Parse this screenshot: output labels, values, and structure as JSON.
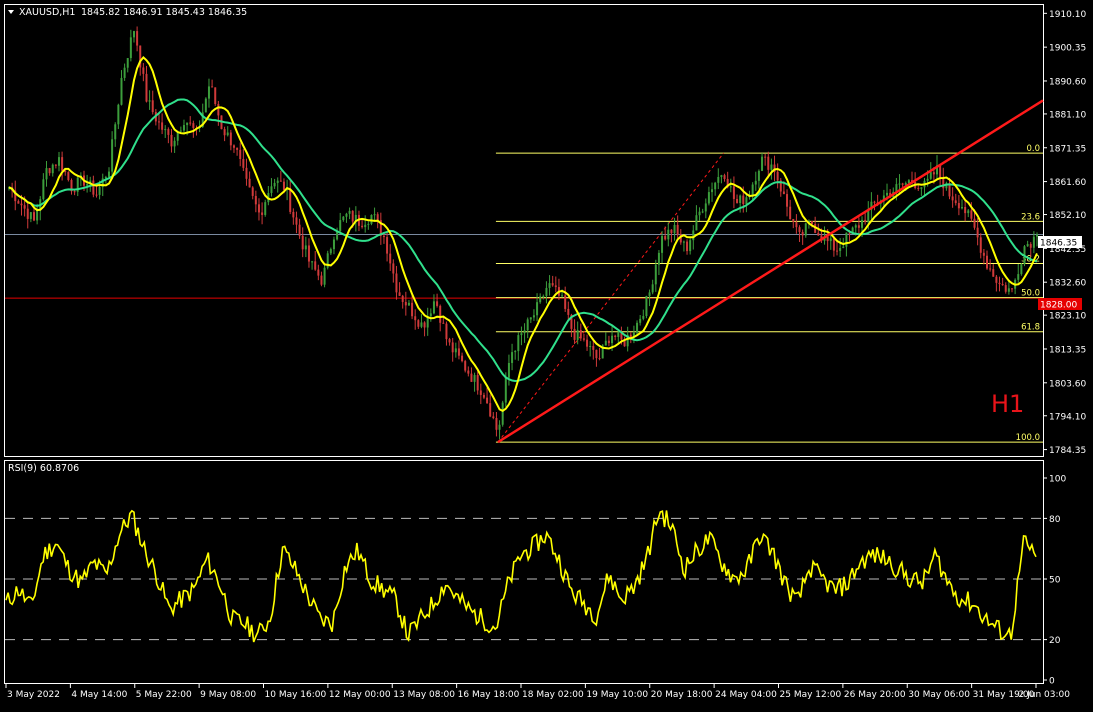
{
  "main": {
    "header": {
      "symbol": "XAUUSD,H1",
      "ohlc": "1845.82 1846.91 1845.43 1846.35"
    },
    "timeframe_label": "H1",
    "current_price_label": "1846.35",
    "level_price_label": "1828.00",
    "fib_labels": [
      "0.0",
      "23.6",
      "38.2",
      "50.0",
      "61.8",
      "100.0"
    ]
  },
  "rsi": {
    "header": "RSI(9) 60.8706"
  },
  "colors": {
    "background": "#000000",
    "axis": "#FFFFFF",
    "bull_candle": "#3C9E3C",
    "bear_candle": "#D03A3A",
    "ma_fast": "#FFFF00",
    "ma_slow": "#30E08C",
    "trendline": "#FF1A1A",
    "fib": "#FFFF66",
    "rsi_line": "#FFFF00",
    "h1_label": "#E8141A",
    "current_price_box": "#FFFFFF",
    "level_box": "#E60000"
  },
  "chart_data": [
    {
      "type": "candlestick",
      "title": "XAUUSD,H1",
      "y_ticks": [
        1910.1,
        1900.35,
        1890.6,
        1881.1,
        1871.35,
        1861.6,
        1852.1,
        1842.35,
        1832.6,
        1823.1,
        1813.35,
        1803.6,
        1794.1,
        1784.35
      ],
      "ylim": [
        1782.5,
        1912.5
      ],
      "x_ticks": [
        "3 May 2022",
        "4 May 14:00",
        "5 May 22:00",
        "9 May 08:00",
        "10 May 16:00",
        "12 May 00:00",
        "13 May 08:00",
        "16 May 18:00",
        "18 May 02:00",
        "19 May 10:00",
        "20 May 18:00",
        "24 May 04:00",
        "25 May 12:00",
        "26 May 20:00",
        "30 May 06:00",
        "31 May 19:00",
        "2 Jun 03:00"
      ],
      "close_path": [
        1860,
        1855,
        1850,
        1865,
        1868,
        1860,
        1862,
        1858,
        1866,
        1892,
        1906,
        1885,
        1878,
        1873,
        1880,
        1875,
        1890,
        1877,
        1872,
        1860,
        1852,
        1862,
        1860,
        1848,
        1838,
        1833,
        1848,
        1852,
        1850,
        1852,
        1845,
        1830,
        1825,
        1820,
        1828,
        1815,
        1810,
        1805,
        1800,
        1789,
        1812,
        1818,
        1824,
        1832,
        1828,
        1818,
        1815,
        1810,
        1818,
        1815,
        1820,
        1828,
        1845,
        1848,
        1842,
        1852,
        1860,
        1865,
        1855,
        1858,
        1868,
        1866,
        1855,
        1845,
        1850,
        1845,
        1842,
        1846,
        1850,
        1855,
        1858,
        1860,
        1862,
        1860,
        1865,
        1858,
        1855,
        1848,
        1838,
        1832,
        1830,
        1843,
        1846
      ],
      "ma_fast": {
        "name": "",
        "color": "#FFFF00"
      },
      "ma_slow": {
        "name": "",
        "color": "#30E08C"
      },
      "trendline": {
        "from": [
          39,
          1786.5
        ],
        "to": [
          82,
          1885
        ]
      },
      "fibonacci": {
        "high": 1869.8,
        "low": 1786.5,
        "levels": [
          0.0,
          23.6,
          38.2,
          50.0,
          61.8,
          100.0
        ]
      },
      "current_price": 1846.35,
      "level_price": 1828.0
    },
    {
      "type": "line",
      "title": "RSI(9) 60.8706",
      "y_ticks": [
        100,
        80,
        50,
        20,
        0
      ],
      "levels": [
        80,
        50,
        20
      ],
      "ylim": [
        0,
        100
      ],
      "x_ticks": [
        "3 May 2022",
        "4 May 14:00",
        "5 May 22:00",
        "9 May 08:00",
        "10 May 16:00",
        "12 May 00:00",
        "13 May 08:00",
        "16 May 18:00",
        "18 May 02:00",
        "19 May 10:00",
        "20 May 18:00",
        "24 May 04:00",
        "25 May 12:00",
        "26 May 20:00",
        "30 May 06:00",
        "31 May 19:00",
        "2 Jun 03:00"
      ],
      "values": [
        38,
        45,
        36,
        62,
        68,
        55,
        48,
        58,
        52,
        72,
        82,
        65,
        52,
        35,
        40,
        45,
        60,
        48,
        30,
        28,
        22,
        30,
        65,
        55,
        42,
        30,
        28,
        56,
        64,
        50,
        45,
        40,
        22,
        30,
        38,
        48,
        40,
        34,
        30,
        26,
        48,
        62,
        66,
        72,
        60,
        44,
        38,
        32,
        52,
        40,
        46,
        60,
        84,
        76,
        55,
        64,
        70,
        58,
        50,
        55,
        72,
        64,
        48,
        38,
        56,
        50,
        44,
        48,
        58,
        62,
        60,
        55,
        50,
        48,
        62,
        48,
        40,
        38,
        30,
        25,
        22,
        68,
        61
      ]
    }
  ]
}
